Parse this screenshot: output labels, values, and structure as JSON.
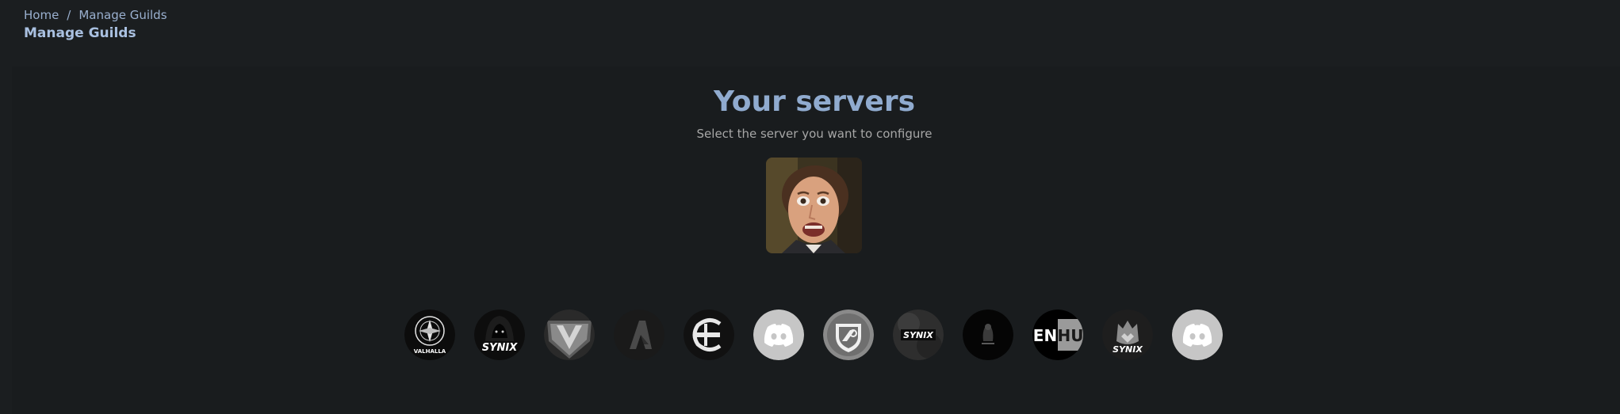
{
  "breadcrumb": {
    "home": "Home",
    "separator": "/",
    "current": "Manage Guilds"
  },
  "header": {
    "title": "Manage Guilds"
  },
  "main": {
    "heading": "Your servers",
    "subheading": "Select the server you want to configure"
  },
  "selected_server": {
    "icon": "server-avatar-photo"
  },
  "guilds": [
    {
      "icon": "valhalla-logo",
      "label_text": "VALHALLA"
    },
    {
      "icon": "synix-hooded-logo",
      "label_text": "SYNIX"
    },
    {
      "icon": "v-shield-logo"
    },
    {
      "icon": "a-logo"
    },
    {
      "icon": "e-circle-logo"
    },
    {
      "icon": "discord-default-icon"
    },
    {
      "icon": "rocket-league-icon"
    },
    {
      "icon": "synix-text-logo",
      "label_text": "SYNIX"
    },
    {
      "icon": "dark-figure-logo"
    },
    {
      "icon": "en-hu-logo",
      "label_text": "EN HU"
    },
    {
      "icon": "synix-wolf-logo",
      "label_text": "SYNIX"
    },
    {
      "icon": "discord-default-icon"
    }
  ],
  "colors": {
    "background": "#1b1e20",
    "panel": "#191c1e",
    "heading": "#90abcf",
    "breadcrumb": "#9ab0cf",
    "discord_default": "#c6c6c6"
  }
}
